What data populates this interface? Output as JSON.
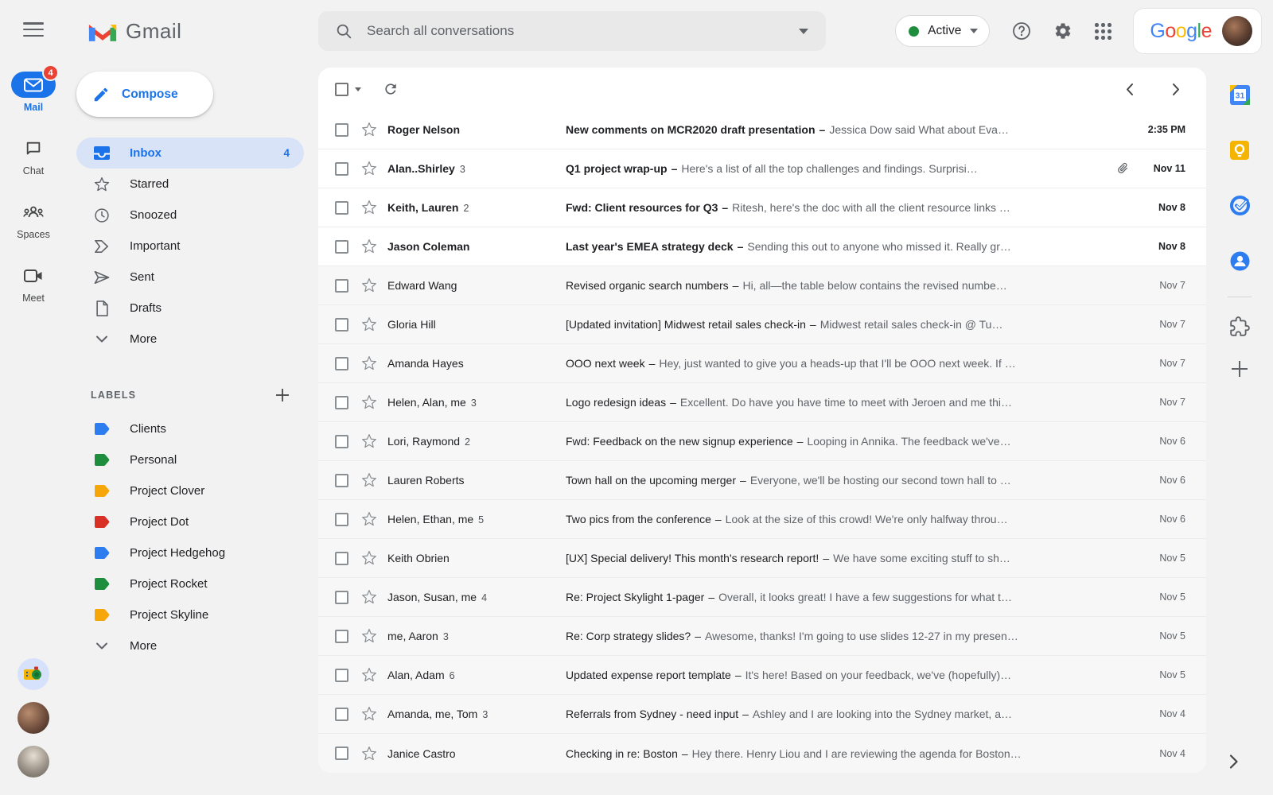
{
  "topbar": {
    "product_name": "Gmail",
    "search_placeholder": "Search all conversations",
    "status_label": "Active",
    "google_letters": [
      {
        "ch": "G",
        "color": "#4285F4"
      },
      {
        "ch": "o",
        "color": "#EA4335"
      },
      {
        "ch": "o",
        "color": "#FBBC05"
      },
      {
        "ch": "g",
        "color": "#4285F4"
      },
      {
        "ch": "l",
        "color": "#34A853"
      },
      {
        "ch": "e",
        "color": "#EA4335"
      }
    ]
  },
  "rail": {
    "items": [
      {
        "label": "Mail",
        "badge": "4",
        "active": true
      },
      {
        "label": "Chat"
      },
      {
        "label": "Spaces"
      },
      {
        "label": "Meet"
      }
    ]
  },
  "sidebar": {
    "compose_label": "Compose",
    "nav": [
      {
        "label": "Inbox",
        "count": "4",
        "selected": true
      },
      {
        "label": "Starred"
      },
      {
        "label": "Snoozed"
      },
      {
        "label": "Important"
      },
      {
        "label": "Sent"
      },
      {
        "label": "Drafts"
      },
      {
        "label": "More"
      }
    ],
    "labels_header": "LABELS",
    "labels": [
      {
        "label": "Clients",
        "color": "#2e7df0"
      },
      {
        "label": "Personal",
        "color": "#1e8e3e"
      },
      {
        "label": "Project Clover",
        "color": "#f6a609"
      },
      {
        "label": "Project Dot",
        "color": "#d93025"
      },
      {
        "label": "Project Hedgehog",
        "color": "#2e7df0"
      },
      {
        "label": "Project Rocket",
        "color": "#1e8e3e"
      },
      {
        "label": "Project Skyline",
        "color": "#f6a609"
      }
    ],
    "labels_more": "More"
  },
  "list": {
    "separator": "–",
    "rows": [
      {
        "sender": "Roger Nelson",
        "count": "",
        "subject": "New comments on MCR2020 draft presentation",
        "snippet": "Jessica Dow said What about Eva…",
        "date": "2:35 PM",
        "unread": true,
        "attachment": false
      },
      {
        "sender": "Alan..Shirley",
        "count": "3",
        "subject": "Q1 project wrap-up",
        "snippet": "Here's a list of all the top challenges and findings. Surprisi…",
        "date": "Nov 11",
        "unread": true,
        "attachment": true
      },
      {
        "sender": "Keith, Lauren",
        "count": "2",
        "subject": "Fwd: Client resources for Q3",
        "snippet": "Ritesh, here's the doc with all the client resource links …",
        "date": "Nov 8",
        "unread": true,
        "attachment": false
      },
      {
        "sender": "Jason Coleman",
        "count": "",
        "subject": "Last year's EMEA strategy deck",
        "snippet": "Sending this out to anyone who missed it. Really gr…",
        "date": "Nov 8",
        "unread": true,
        "attachment": false
      },
      {
        "sender": "Edward Wang",
        "count": "",
        "subject": "Revised organic search numbers",
        "snippet": "Hi, all—the table below contains the revised numbe…",
        "date": "Nov 7",
        "unread": false,
        "attachment": false
      },
      {
        "sender": "Gloria Hill",
        "count": "",
        "subject": "[Updated invitation] Midwest retail sales check-in",
        "snippet": "Midwest retail sales check-in @ Tu…",
        "date": "Nov 7",
        "unread": false,
        "attachment": false
      },
      {
        "sender": "Amanda Hayes",
        "count": "",
        "subject": "OOO next week",
        "snippet": "Hey, just wanted to give you a heads-up that I'll be OOO next week. If …",
        "date": "Nov 7",
        "unread": false,
        "attachment": false
      },
      {
        "sender": "Helen, Alan, me",
        "count": "3",
        "subject": "Logo redesign ideas",
        "snippet": "Excellent. Do have you have time to meet with Jeroen and me thi…",
        "date": "Nov 7",
        "unread": false,
        "attachment": false
      },
      {
        "sender": "Lori, Raymond",
        "count": "2",
        "subject": "Fwd: Feedback on the new signup experience",
        "snippet": "Looping in Annika. The feedback we've…",
        "date": "Nov 6",
        "unread": false,
        "attachment": false
      },
      {
        "sender": "Lauren Roberts",
        "count": "",
        "subject": "Town hall on the upcoming merger",
        "snippet": "Everyone, we'll be hosting our second town hall to …",
        "date": "Nov 6",
        "unread": false,
        "attachment": false
      },
      {
        "sender": "Helen, Ethan, me",
        "count": "5",
        "subject": "Two pics from the conference",
        "snippet": "Look at the size of this crowd! We're only halfway throu…",
        "date": "Nov 6",
        "unread": false,
        "attachment": false
      },
      {
        "sender": "Keith Obrien",
        "count": "",
        "subject": "[UX] Special delivery! This month's research report!",
        "snippet": "We have some exciting stuff to sh…",
        "date": "Nov 5",
        "unread": false,
        "attachment": false
      },
      {
        "sender": "Jason, Susan, me",
        "count": "4",
        "subject": "Re: Project Skylight 1-pager",
        "snippet": "Overall, it looks great! I have a few suggestions for what t…",
        "date": "Nov 5",
        "unread": false,
        "attachment": false
      },
      {
        "sender": "me, Aaron",
        "count": "3",
        "subject": "Re: Corp strategy slides?",
        "snippet": "Awesome, thanks! I'm going to use slides 12-27 in my presen…",
        "date": "Nov 5",
        "unread": false,
        "attachment": false
      },
      {
        "sender": "Alan, Adam",
        "count": "6",
        "subject": "Updated expense report template",
        "snippet": "It's here! Based on your feedback, we've (hopefully)…",
        "date": "Nov 5",
        "unread": false,
        "attachment": false
      },
      {
        "sender": "Amanda, me, Tom",
        "count": "3",
        "subject": "Referrals from Sydney - need input",
        "snippet": "Ashley and I are looking into the Sydney market, a…",
        "date": "Nov 4",
        "unread": false,
        "attachment": false
      },
      {
        "sender": "Janice Castro",
        "count": "",
        "subject": "Checking in re: Boston",
        "snippet": "Hey there. Henry Liou and I are reviewing the agenda for Boston…",
        "date": "Nov 4",
        "unread": false,
        "attachment": false
      }
    ]
  }
}
